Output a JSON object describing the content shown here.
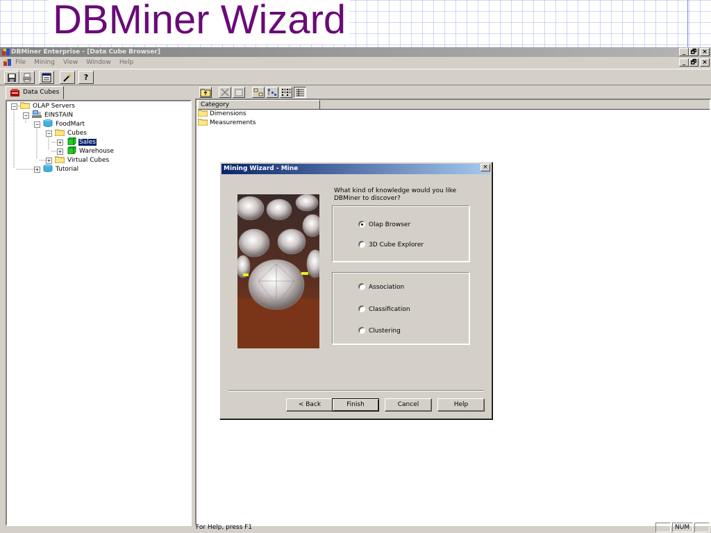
{
  "slide": {
    "title": "DBMiner Wizard"
  },
  "app": {
    "title": "DBMiner Enterprise - [Data Cube Browser]",
    "window_buttons": [
      "_",
      "□",
      "×"
    ],
    "menu": [
      "File",
      "Mining",
      "View",
      "Window",
      "Help"
    ],
    "toolbar": {
      "help_label": "?"
    }
  },
  "left_pane": {
    "tab_label": "Data Cubes",
    "tree": {
      "olap_servers": "OLAP Servers",
      "server": "EINSTAIN",
      "foodmart": "FoodMart",
      "cubes": "Cubes",
      "sales": "Sales",
      "warehouse": "Warehouse",
      "virtual_cubes": "Virtual Cubes",
      "tutorial": "Tutorial"
    }
  },
  "right_pane": {
    "column_header": "Category",
    "items": [
      "Dimensions",
      "Measurements"
    ]
  },
  "status_bar": {
    "help_text": "For Help, press F1",
    "num": "NUM"
  },
  "dialog": {
    "title": "Mining Wizard - Mine",
    "close_label": "×",
    "question": "What kind of knowledge would you like DBMiner to discover?",
    "group1": [
      {
        "label": "Olap Browser",
        "checked": true
      },
      {
        "label": "3D Cube Explorer",
        "checked": false
      }
    ],
    "group2": [
      {
        "label": "Association",
        "checked": false
      },
      {
        "label": "Classification",
        "checked": false
      },
      {
        "label": "Clustering",
        "checked": false
      }
    ],
    "buttons": {
      "back": "< Back",
      "finish": "Finish",
      "cancel": "Cancel",
      "help": "Help"
    }
  },
  "colors": {
    "title_color": "#6a0a78",
    "dialog_title_bg": "#0a246a",
    "selection_bg": "#0a246a",
    "cube_green": "#22cc22",
    "folder_yellow": "#ffe680"
  }
}
